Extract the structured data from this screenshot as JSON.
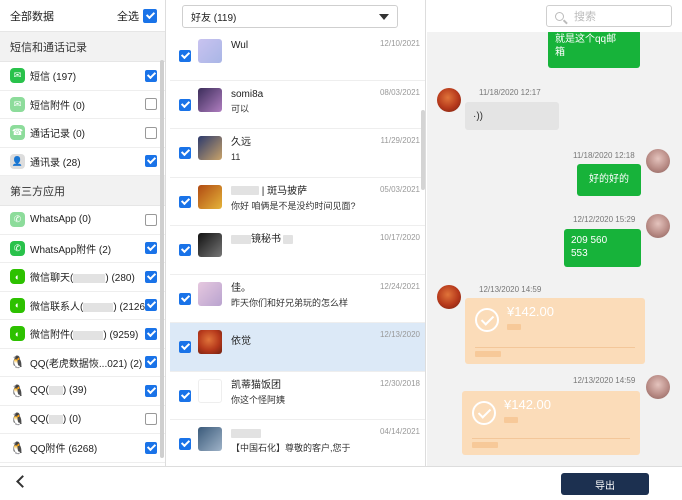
{
  "left": {
    "all_label": "全部数据",
    "select_all_label": "全选",
    "section1": "短信和通话记录",
    "section2": "第三方应用",
    "categories": [
      {
        "label": "短信 (197)",
        "icon": "sms-icon",
        "checked": true
      },
      {
        "label": "短信附件 (0)",
        "icon": "sms-attachment-icon",
        "checked": false
      },
      {
        "label": "通话记录 (0)",
        "icon": "phone-icon",
        "checked": false
      },
      {
        "label": "通讯录 (28)",
        "icon": "contacts-icon",
        "checked": true
      },
      {
        "label": "WhatsApp (0)",
        "icon": "whatsapp-icon",
        "checked": false
      },
      {
        "label": "WhatsApp附件 (2)",
        "icon": "whatsapp-icon",
        "checked": true
      },
      {
        "label_a": "微信聊天(",
        "label_b": ") (280)",
        "icon": "wechat-icon",
        "checked": true
      },
      {
        "label_a": "微信联系人(",
        "label_b": ") (2126)",
        "icon": "wechat-icon",
        "checked": true
      },
      {
        "label_a": "微信附件(",
        "label_b": ") (9259)",
        "icon": "wechat-icon",
        "checked": true
      },
      {
        "label": "QQ(老虎数据恢...021) (2)",
        "icon": "qq-icon",
        "checked": true
      },
      {
        "label_a": "QQ(",
        "label_b": ") (39)",
        "icon": "qq-icon",
        "checked": true
      },
      {
        "label_a": "QQ(",
        "label_b": ") (0)",
        "icon": "qq-icon",
        "checked": false
      },
      {
        "label": "QQ附件 (6268)",
        "icon": "qq-icon",
        "checked": true
      }
    ]
  },
  "toolbar": {
    "filter_value": "好友 (119)",
    "search_placeholder": "搜索"
  },
  "conversations": [
    {
      "name": "Wul",
      "message": "",
      "date": "12/10/2021"
    },
    {
      "name": "somi8a",
      "message": "可以",
      "date": "08/03/2021"
    },
    {
      "name": "久远",
      "message": "11",
      "date": "11/29/2021"
    },
    {
      "name": "| 斑马披萨",
      "message": "你好 咱俩是不是没约时间见面?",
      "date": "05/03/2021"
    },
    {
      "name": "镜秘书",
      "message": "",
      "date": "10/17/2020"
    },
    {
      "name": "佳。",
      "message": "昨天你们和好兄弟玩的怎么样",
      "date": "12/24/2021"
    },
    {
      "name": "依觉",
      "message": "",
      "date": "12/13/2020"
    },
    {
      "name": "凯蒂猫饭团",
      "message": "你这个怪阿姨",
      "date": "12/30/2018"
    },
    {
      "name": "",
      "message": "【中国石化】尊敬的客户,您于",
      "date": "04/14/2021"
    }
  ],
  "chat": {
    "bubble1": "就是这个qq邮\n箱",
    "ts1": "11/18/2020 12:17",
    "voice": "·))",
    "ts2": "11/18/2020 12:18",
    "bubble2": "好的好的",
    "ts3": "12/12/2020 15:29",
    "bubble3": "209 560\n553",
    "ts4": "12/13/2020 14:59",
    "amount1": "¥142.00",
    "ts5": "12/13/2020 14:59",
    "amount2": "¥142.00"
  },
  "bottom": {
    "export_label": "导出"
  }
}
